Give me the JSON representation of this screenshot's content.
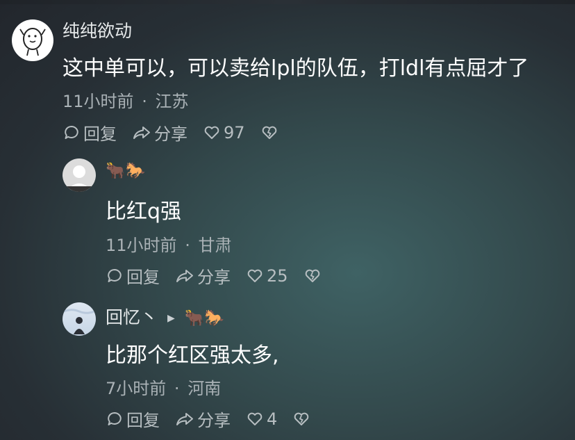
{
  "comments": [
    {
      "nickname": "纯纯欲动",
      "content": "这中单可以，可以卖给lpl的队伍，打ldl有点屈才了",
      "time": "11小时前",
      "location": "江苏",
      "reply_label": "回复",
      "share_label": "分享",
      "likes": "97",
      "avatar_icon": "doodle-avatar"
    },
    {
      "nickname": "",
      "nickname_emoji": "🐂🐎",
      "content": "比红q强",
      "time": "11小时前",
      "location": "甘肃",
      "reply_label": "回复",
      "share_label": "分享",
      "likes": "25",
      "avatar_icon": "default-avatar"
    },
    {
      "nickname": "回忆丶",
      "nickname_emoji": "🐂🐎",
      "content": "比那个红区强太多,",
      "time": "7小时前",
      "location": "河南",
      "reply_label": "回复",
      "share_label": "分享",
      "likes": "4",
      "avatar_icon": "photo-avatar"
    }
  ],
  "separator": "·",
  "colors": {
    "background_center": "#3f6264",
    "background_edge": "#22262c",
    "text_primary": "#ffffff",
    "text_meta": "#aab2b6"
  }
}
